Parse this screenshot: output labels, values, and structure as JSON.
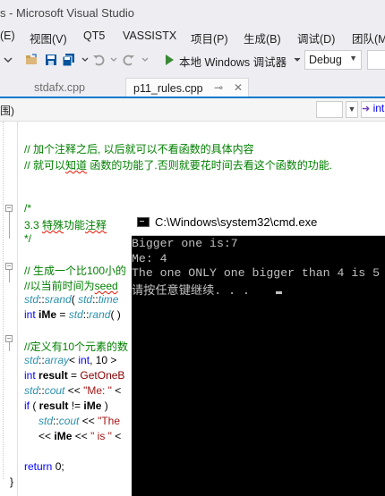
{
  "window": {
    "title": "s - Microsoft Visual Studio"
  },
  "menu": [
    "(E)",
    "视图(V)",
    "QT5",
    "VASSISTX",
    "项目(P)",
    "生成(B)",
    "调试(D)",
    "团队(M"
  ],
  "toolbar": {
    "run_label": "本地 Windows 调试器",
    "config": "Debug"
  },
  "tabs": [
    {
      "label": "stdafx.cpp",
      "active": false
    },
    {
      "label": "p11_rules.cpp",
      "active": true
    }
  ],
  "navbar": {
    "left": "围)",
    "scope_value": "int",
    "function_prefix": "int r"
  },
  "code_lines": [
    [
      "// 加个注释之后, 以后就可以不看函数的具体内容"
    ],
    [
      "// 就可以知道 函数的功能了.否则就要花时间去看这个函数的功能."
    ],
    [
      ""
    ],
    [
      ""
    ],
    [
      "/*"
    ],
    [
      "3.3 特殊功能注释"
    ],
    [
      "*/"
    ],
    [
      ""
    ],
    [
      "// 生成一个比100小的"
    ],
    [
      "//以当前时间为seed"
    ],
    [
      "std::srand( std::time"
    ],
    [
      "int iMe = std::rand( )"
    ],
    [
      ""
    ],
    [
      "//定义有10个元素的数"
    ],
    [
      "std::array< int, 10 >"
    ],
    [
      "int result = GetOneB"
    ],
    [
      "std::cout << \"Me: \" <"
    ],
    [
      "if ( result != iMe )"
    ],
    [
      "std::cout << \"The"
    ],
    [
      "<< iMe << \" is \" <"
    ],
    [
      ""
    ],
    [
      "return 0;"
    ],
    [
      "}"
    ]
  ],
  "cmd": {
    "title": "C:\\Windows\\system32\\cmd.exe",
    "lines": [
      "Bigger one is:7",
      "Me: 4",
      "The one ONLY one bigger than 4 is 5",
      "请按任意键继续. . ."
    ]
  }
}
